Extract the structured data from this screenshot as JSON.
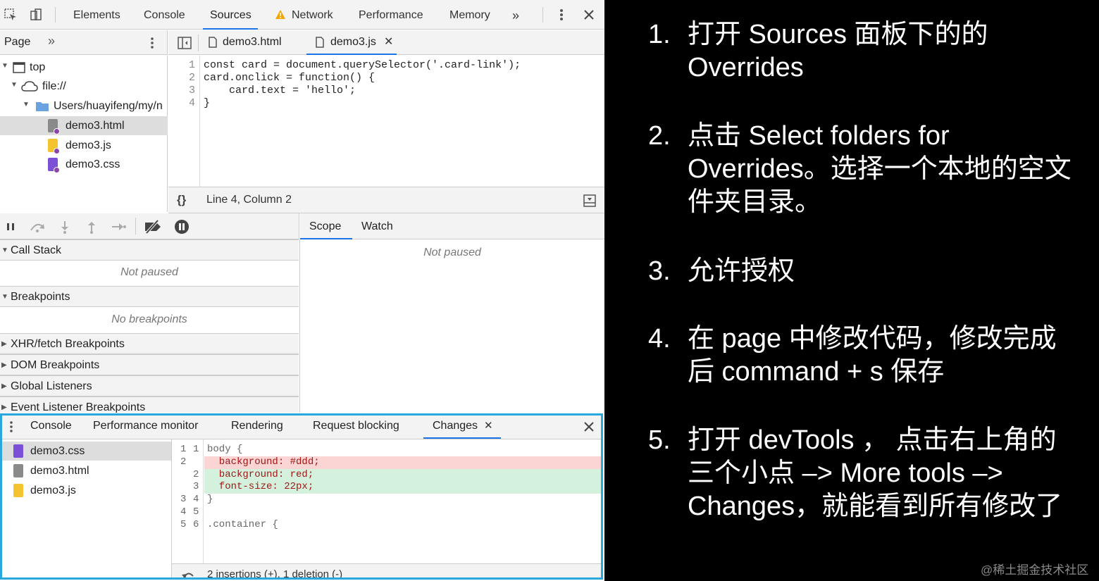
{
  "top_tabs": [
    "Elements",
    "Console",
    "Sources",
    "Network",
    "Performance",
    "Memory"
  ],
  "active_top_tab": "Sources",
  "left_panel": {
    "label": "Page"
  },
  "file_tree": {
    "top": "top",
    "origin": "file://",
    "folder": "Users/huayifeng/my/n",
    "files": [
      "demo3.html",
      "demo3.js",
      "demo3.css"
    ]
  },
  "editor_tabs": [
    "demo3.html",
    "demo3.js"
  ],
  "code_lines": [
    {
      "n": "1",
      "text": "const card = document.querySelector('.card-link');"
    },
    {
      "n": "2",
      "text": "card.onclick = function() {"
    },
    {
      "n": "3",
      "text": "    card.text = 'hello';"
    },
    {
      "n": "4",
      "text": "}"
    }
  ],
  "status": {
    "position": "Line 4, Column 2",
    "braces": "{}"
  },
  "debug": {
    "call_stack": "Call Stack",
    "not_paused": "Not paused",
    "breakpoints": "Breakpoints",
    "no_breakpoints": "No breakpoints",
    "xhr": "XHR/fetch Breakpoints",
    "dom": "DOM Breakpoints",
    "global": "Global Listeners",
    "event": "Event Listener Breakpoints"
  },
  "scope_tabs": [
    "Scope",
    "Watch"
  ],
  "scope_not_paused": "Not paused",
  "drawer_tabs": [
    "Console",
    "Performance monitor",
    "Rendering",
    "Request blocking",
    "Changes"
  ],
  "changes": {
    "files": [
      "demo3.css",
      "demo3.html",
      "demo3.js"
    ],
    "lines": [
      {
        "a": "1",
        "b": "1",
        "text": "body {",
        "type": "ctx"
      },
      {
        "a": "2",
        "b": "",
        "text": "  background: #ddd;",
        "type": "del"
      },
      {
        "a": "",
        "b": "2",
        "text": "  background: red;",
        "type": "add"
      },
      {
        "a": "",
        "b": "3",
        "text": "  font-size: 22px;",
        "type": "add"
      },
      {
        "a": "3",
        "b": "4",
        "text": "}",
        "type": "ctx"
      },
      {
        "a": "4",
        "b": "5",
        "text": "",
        "type": "ctx"
      },
      {
        "a": "5",
        "b": "6",
        "text": ".container {",
        "type": "ctx"
      }
    ],
    "summary": "2 insertions (+), 1 deletion (-)"
  },
  "instructions": [
    {
      "num": "1.",
      "text": "打开 Sources 面板下的的\nOverrides"
    },
    {
      "num": "2.",
      "text": "点击 Select folders for\nOverrides。选择一个本地的空文\n件夹目录。"
    },
    {
      "num": "3.",
      "text": "允许授权"
    },
    {
      "num": "4.",
      "text": "在 page 中修改代码，修改完成\n后 command + s 保存"
    },
    {
      "num": "5.",
      "text": "打开 devTools ， 点击右上角的\n三个小点 –> More tools –>\nChanges，就能看到所有修改了"
    }
  ],
  "watermark": "@稀土掘金技术社区",
  "colors": {
    "accent": "#1a73e8",
    "highlight_border": "#29a8dd",
    "del_bg": "#fbd4d4",
    "add_bg": "#d4f1dd"
  }
}
